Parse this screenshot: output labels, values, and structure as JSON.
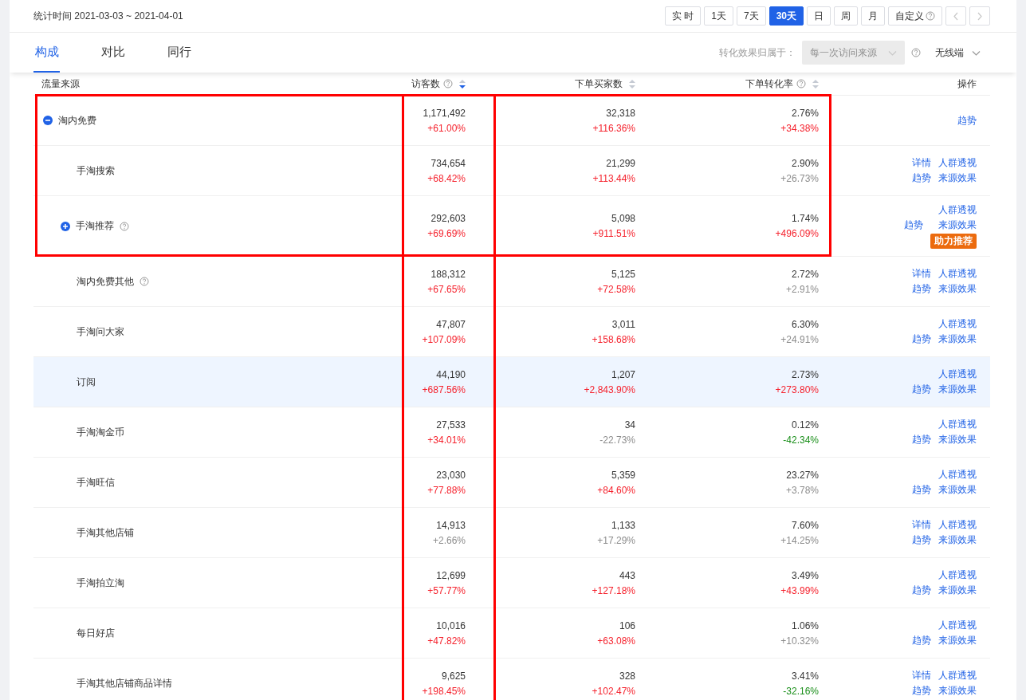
{
  "header": {
    "period": "统计时间 2021-03-03 ~ 2021-04-01",
    "ranges": [
      {
        "label": "实 时",
        "selected": false,
        "help": false
      },
      {
        "label": "1天",
        "selected": false,
        "help": false
      },
      {
        "label": "7天",
        "selected": false,
        "help": false
      },
      {
        "label": "30天",
        "selected": true,
        "help": false
      },
      {
        "label": "日",
        "selected": false,
        "help": false
      },
      {
        "label": "周",
        "selected": false,
        "help": false
      },
      {
        "label": "月",
        "selected": false,
        "help": false
      },
      {
        "label": "自定义",
        "selected": false,
        "help": true
      }
    ],
    "pager": [
      {
        "kind": "prev",
        "disabled": true
      },
      {
        "kind": "next",
        "disabled": true
      }
    ]
  },
  "tabs": [
    {
      "label": "构成",
      "selected": true
    },
    {
      "label": "对比",
      "selected": false
    },
    {
      "label": "同行",
      "selected": false
    }
  ],
  "attribution": {
    "label": "转化效果归属于：",
    "value": "每一次访问来源",
    "disabled": true,
    "help": true
  },
  "device": {
    "value": "无线端"
  },
  "table": {
    "columns": [
      {
        "label": "流量来源",
        "kind": "source",
        "help": false,
        "boxed": false
      },
      {
        "label": "访客数",
        "kind": "metric",
        "help": true,
        "sorted": true,
        "boxed": true
      },
      {
        "label": "下单买家数",
        "kind": "metric",
        "help": false,
        "sorted": false,
        "boxed": false
      },
      {
        "label": "下单转化率",
        "kind": "metric",
        "help": true,
        "sorted": false,
        "boxed": false
      },
      {
        "label": "操作",
        "kind": "actions",
        "help": false,
        "boxed": false
      }
    ],
    "rows": [
      {
        "name": "淘内免费",
        "expanded": true,
        "help": false,
        "boxed": true,
        "highlighted": false,
        "metrics": [
          {
            "value": "1,171,492",
            "change": "+61.00%",
            "color": "#f5222d"
          },
          {
            "value": "32,318",
            "change": "+116.36%",
            "color": "#f5222d"
          },
          {
            "value": "2.76%",
            "change": "+34.38%",
            "color": "#f5222d"
          }
        ],
        "actions": [
          {
            "label": "趋势",
            "kind": "trend"
          }
        ],
        "children": [
          {
            "name": "手淘搜索",
            "help": false,
            "boxed": true,
            "highlighted": false,
            "metrics": [
              {
                "value": "734,654",
                "change": "+68.42%",
                "color": "#f5222d"
              },
              {
                "value": "21,299",
                "change": "+113.44%",
                "color": "#f5222d"
              },
              {
                "value": "2.90%",
                "change": "+26.73%",
                "color": "#8c8c8c"
              }
            ],
            "actions": [
              {
                "label": "详情",
                "kind": "detail"
              },
              {
                "label": "人群透视",
                "kind": "crowd"
              },
              {
                "label": "趋势",
                "kind": "trend"
              },
              {
                "label": "来源效果",
                "kind": "effect"
              }
            ]
          },
          {
            "name": "手淘推荐",
            "expanded": false,
            "help": true,
            "boxed": true,
            "highlighted": false,
            "metrics": [
              {
                "value": "292,603",
                "change": "+69.69%",
                "color": "#f5222d"
              },
              {
                "value": "5,098",
                "change": "+911.51%",
                "color": "#f5222d"
              },
              {
                "value": "1.74%",
                "change": "+496.09%",
                "color": "#f5222d"
              }
            ],
            "actions": [
              {
                "label": "人群透视",
                "kind": "crowd"
              },
              {
                "label": "趋势",
                "kind": "trend"
              },
              {
                "label": "来源效果",
                "kind": "effect"
              },
              {
                "label": "助力推荐",
                "kind": "badge"
              }
            ]
          },
          {
            "name": "淘内免费其他",
            "help": true,
            "boxed": false,
            "highlighted": false,
            "metrics": [
              {
                "value": "188,312",
                "change": "+67.65%",
                "color": "#f5222d"
              },
              {
                "value": "5,125",
                "change": "+72.58%",
                "color": "#f5222d"
              },
              {
                "value": "2.72%",
                "change": "+2.91%",
                "color": "#8c8c8c"
              }
            ],
            "actions": [
              {
                "label": "详情",
                "kind": "detail"
              },
              {
                "label": "人群透视",
                "kind": "crowd"
              },
              {
                "label": "趋势",
                "kind": "trend"
              },
              {
                "label": "来源效果",
                "kind": "effect"
              }
            ]
          },
          {
            "name": "手淘问大家",
            "help": false,
            "boxed": false,
            "highlighted": false,
            "metrics": [
              {
                "value": "47,807",
                "change": "+107.09%",
                "color": "#f5222d"
              },
              {
                "value": "3,011",
                "change": "+158.68%",
                "color": "#f5222d"
              },
              {
                "value": "6.30%",
                "change": "+24.91%",
                "color": "#8c8c8c"
              }
            ],
            "actions": [
              {
                "label": "人群透视",
                "kind": "crowd"
              },
              {
                "label": "趋势",
                "kind": "trend"
              },
              {
                "label": "来源效果",
                "kind": "effect"
              }
            ]
          },
          {
            "name": "订阅",
            "help": false,
            "boxed": false,
            "highlighted": true,
            "metrics": [
              {
                "value": "44,190",
                "change": "+687.56%",
                "color": "#f5222d"
              },
              {
                "value": "1,207",
                "change": "+2,843.90%",
                "color": "#f5222d"
              },
              {
                "value": "2.73%",
                "change": "+273.80%",
                "color": "#f5222d"
              }
            ],
            "actions": [
              {
                "label": "人群透视",
                "kind": "crowd"
              },
              {
                "label": "趋势",
                "kind": "trend"
              },
              {
                "label": "来源效果",
                "kind": "effect"
              }
            ]
          },
          {
            "name": "手淘淘金币",
            "help": false,
            "boxed": false,
            "highlighted": false,
            "metrics": [
              {
                "value": "27,533",
                "change": "+34.01%",
                "color": "#f5222d"
              },
              {
                "value": "34",
                "change": "-22.73%",
                "color": "#8c8c8c"
              },
              {
                "value": "0.12%",
                "change": "-42.34%",
                "color": "#1a8f1a"
              }
            ],
            "actions": [
              {
                "label": "人群透视",
                "kind": "crowd"
              },
              {
                "label": "趋势",
                "kind": "trend"
              },
              {
                "label": "来源效果",
                "kind": "effect"
              }
            ]
          },
          {
            "name": "手淘旺信",
            "help": false,
            "boxed": false,
            "highlighted": false,
            "metrics": [
              {
                "value": "23,030",
                "change": "+77.88%",
                "color": "#f5222d"
              },
              {
                "value": "5,359",
                "change": "+84.60%",
                "color": "#f5222d"
              },
              {
                "value": "23.27%",
                "change": "+3.78%",
                "color": "#8c8c8c"
              }
            ],
            "actions": [
              {
                "label": "人群透视",
                "kind": "crowd"
              },
              {
                "label": "趋势",
                "kind": "trend"
              },
              {
                "label": "来源效果",
                "kind": "effect"
              }
            ]
          },
          {
            "name": "手淘其他店铺",
            "help": false,
            "boxed": false,
            "highlighted": false,
            "metrics": [
              {
                "value": "14,913",
                "change": "+2.66%",
                "color": "#8c8c8c"
              },
              {
                "value": "1,133",
                "change": "+17.29%",
                "color": "#8c8c8c"
              },
              {
                "value": "7.60%",
                "change": "+14.25%",
                "color": "#8c8c8c"
              }
            ],
            "actions": [
              {
                "label": "详情",
                "kind": "detail"
              },
              {
                "label": "人群透视",
                "kind": "crowd"
              },
              {
                "label": "趋势",
                "kind": "trend"
              },
              {
                "label": "来源效果",
                "kind": "effect"
              }
            ]
          },
          {
            "name": "手淘拍立淘",
            "help": false,
            "boxed": false,
            "highlighted": false,
            "metrics": [
              {
                "value": "12,699",
                "change": "+57.77%",
                "color": "#f5222d"
              },
              {
                "value": "443",
                "change": "+127.18%",
                "color": "#f5222d"
              },
              {
                "value": "3.49%",
                "change": "+43.99%",
                "color": "#f5222d"
              }
            ],
            "actions": [
              {
                "label": "人群透视",
                "kind": "crowd"
              },
              {
                "label": "趋势",
                "kind": "trend"
              },
              {
                "label": "来源效果",
                "kind": "effect"
              }
            ]
          },
          {
            "name": "每日好店",
            "help": false,
            "boxed": false,
            "highlighted": false,
            "metrics": [
              {
                "value": "10,016",
                "change": "+47.82%",
                "color": "#f5222d"
              },
              {
                "value": "106",
                "change": "+63.08%",
                "color": "#f5222d"
              },
              {
                "value": "1.06%",
                "change": "+10.32%",
                "color": "#8c8c8c"
              }
            ],
            "actions": [
              {
                "label": "人群透视",
                "kind": "crowd"
              },
              {
                "label": "趋势",
                "kind": "trend"
              },
              {
                "label": "来源效果",
                "kind": "effect"
              }
            ]
          },
          {
            "name": "手淘其他店铺商品详情",
            "help": false,
            "boxed": false,
            "highlighted": false,
            "metrics": [
              {
                "value": "9,625",
                "change": "+198.45%",
                "color": "#f5222d"
              },
              {
                "value": "328",
                "change": "+102.47%",
                "color": "#f5222d"
              },
              {
                "value": "3.41%",
                "change": "-32.16%",
                "color": "#1a8f1a"
              }
            ],
            "actions": [
              {
                "label": "详情",
                "kind": "detail"
              },
              {
                "label": "人群透视",
                "kind": "crowd"
              },
              {
                "label": "趋势",
                "kind": "trend"
              },
              {
                "label": "来源效果",
                "kind": "effect"
              }
            ]
          }
        ]
      }
    ]
  }
}
